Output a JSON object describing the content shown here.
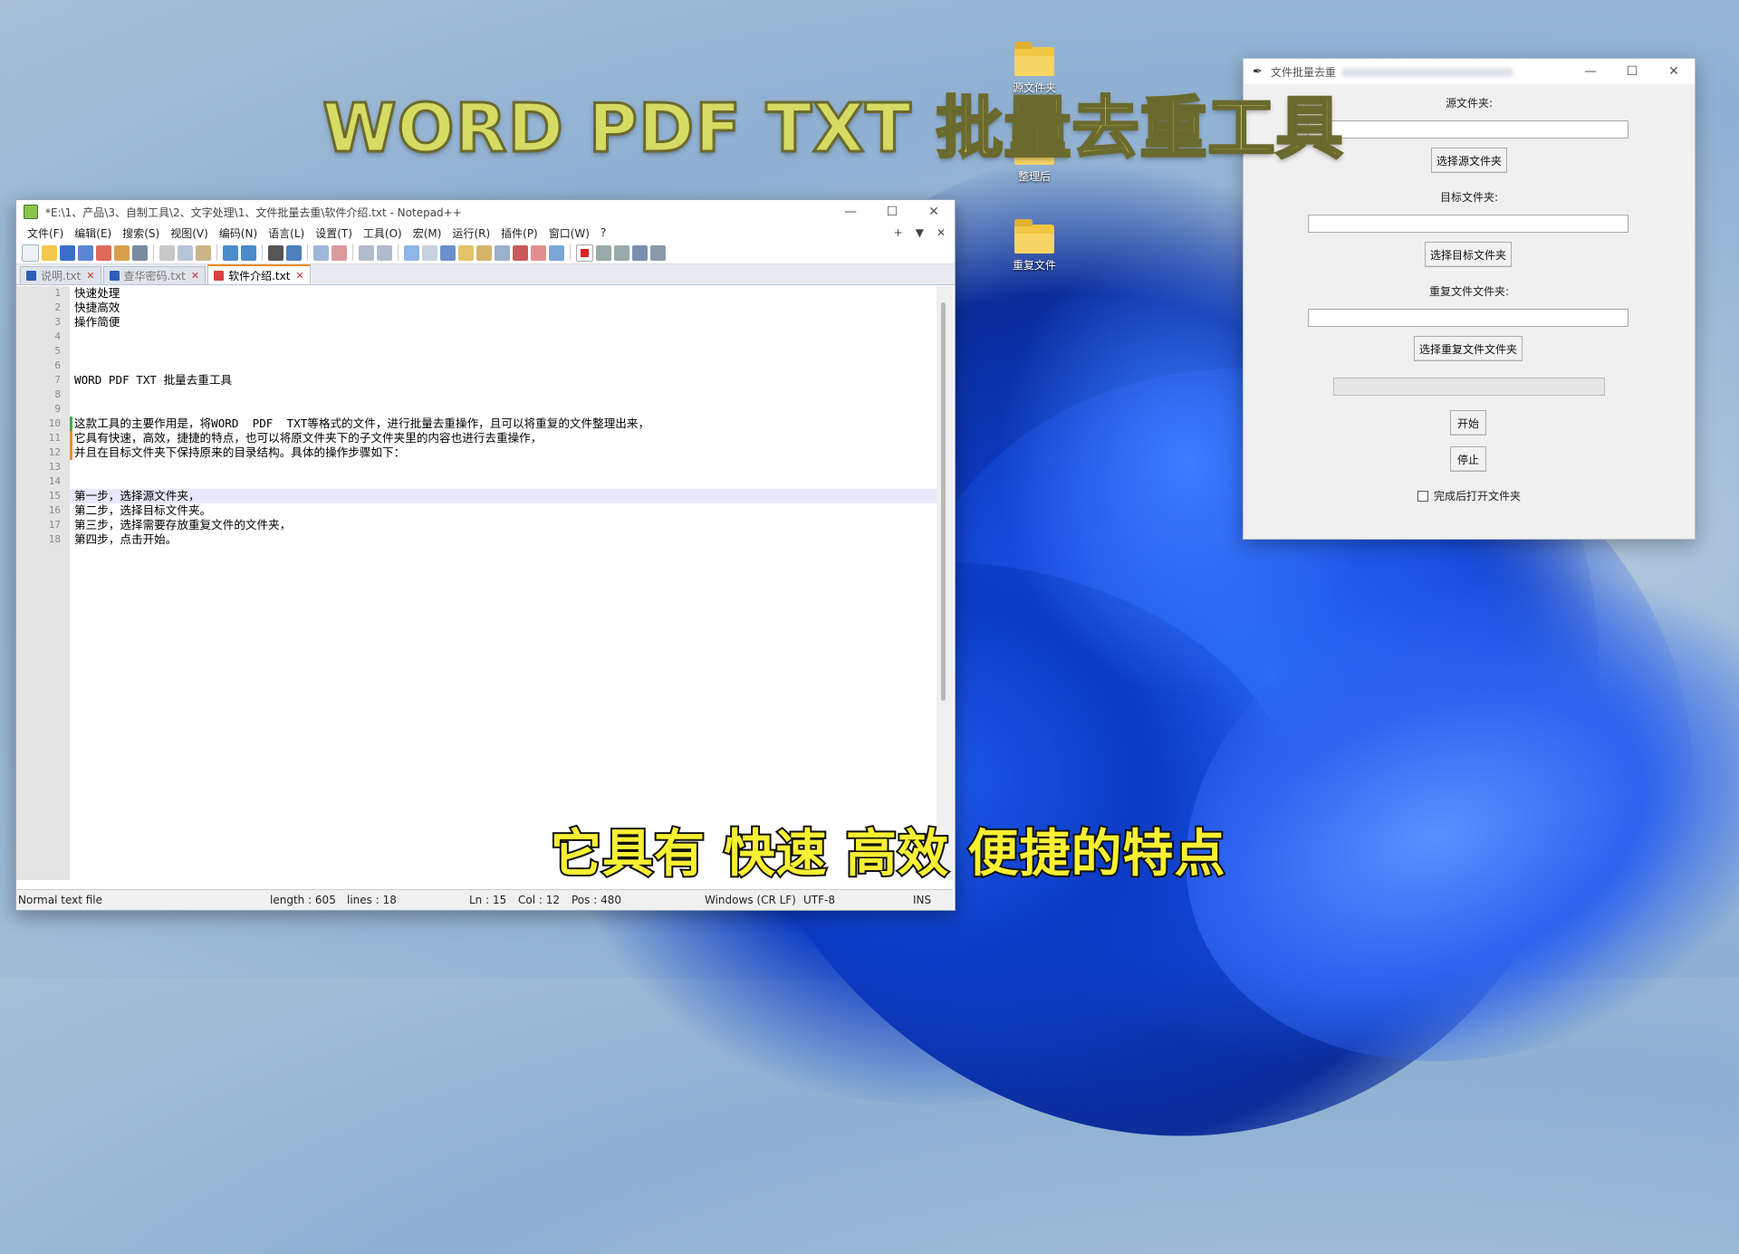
{
  "overlay": {
    "title": "WORD PDF TXT 批量去重工具",
    "subtitle": "它具有 快速 高效 便捷的特点"
  },
  "desktop_icons": [
    {
      "name": "源文件夹",
      "icon": "folder-icon"
    },
    {
      "name": "整理后",
      "icon": "folder-icon"
    },
    {
      "name": "重复文件",
      "icon": "folder-icon"
    }
  ],
  "notepad": {
    "title": "*E:\\1、产品\\3、自制工具\\2、文字处理\\1、文件批量去重\\软件介绍.txt - Notepad++",
    "menu": [
      "文件(F)",
      "编辑(E)",
      "搜索(S)",
      "视图(V)",
      "编码(N)",
      "语言(L)",
      "设置(T)",
      "工具(O)",
      "宏(M)",
      "运行(R)",
      "插件(P)",
      "窗口(W)",
      "?"
    ],
    "menu_right": [
      "+",
      "▼",
      "✕"
    ],
    "tabs": [
      {
        "label": "说明.txt",
        "active": false
      },
      {
        "label": "查华密码.txt",
        "active": false
      },
      {
        "label": "软件介绍.txt",
        "active": true
      }
    ],
    "lines": [
      "快速处理",
      "快捷高效",
      "操作简便",
      "",
      "",
      "",
      "WORD PDF TXT 批量去重工具",
      "",
      "",
      "这款工具的主要作用是，将WORD  PDF  TXT等格式的文件，进行批量去重操作，且可以将重复的文件整理出来，",
      "它具有快速，高效，捷捷的特点，也可以将原文件夹下的子文件夹里的内容也进行去重操作，",
      "并且在目标文件夹下保持原来的目录结构。具体的操作步骤如下：",
      "",
      "",
      "第一步，选择源文件夹，",
      "第二步，选择目标文件夹。",
      "第三步，选择需要存放重复文件的文件夹，",
      "第四步，点击开始。"
    ],
    "status": {
      "type": "Normal text file",
      "length": "length : 605",
      "lines": "lines : 18",
      "ln": "Ln : 15",
      "col": "Col : 12",
      "pos": "Pos : 480",
      "eol": "Windows (CR LF)",
      "encoding": "UTF-8",
      "mode": "INS"
    }
  },
  "tool": {
    "title": "文件批量去重",
    "source_label": "源文件夹:",
    "source_value": "",
    "source_button": "选择源文件夹",
    "target_label": "目标文件夹:",
    "target_value": "",
    "target_button": "选择目标文件夹",
    "dup_label": "重复文件文件夹:",
    "dup_value": "",
    "dup_button": "选择重复文件文件夹",
    "progress": 0,
    "start_button": "开始",
    "stop_button": "停止",
    "open_after_label": "完成后打开文件夹",
    "open_after_checked": false
  }
}
